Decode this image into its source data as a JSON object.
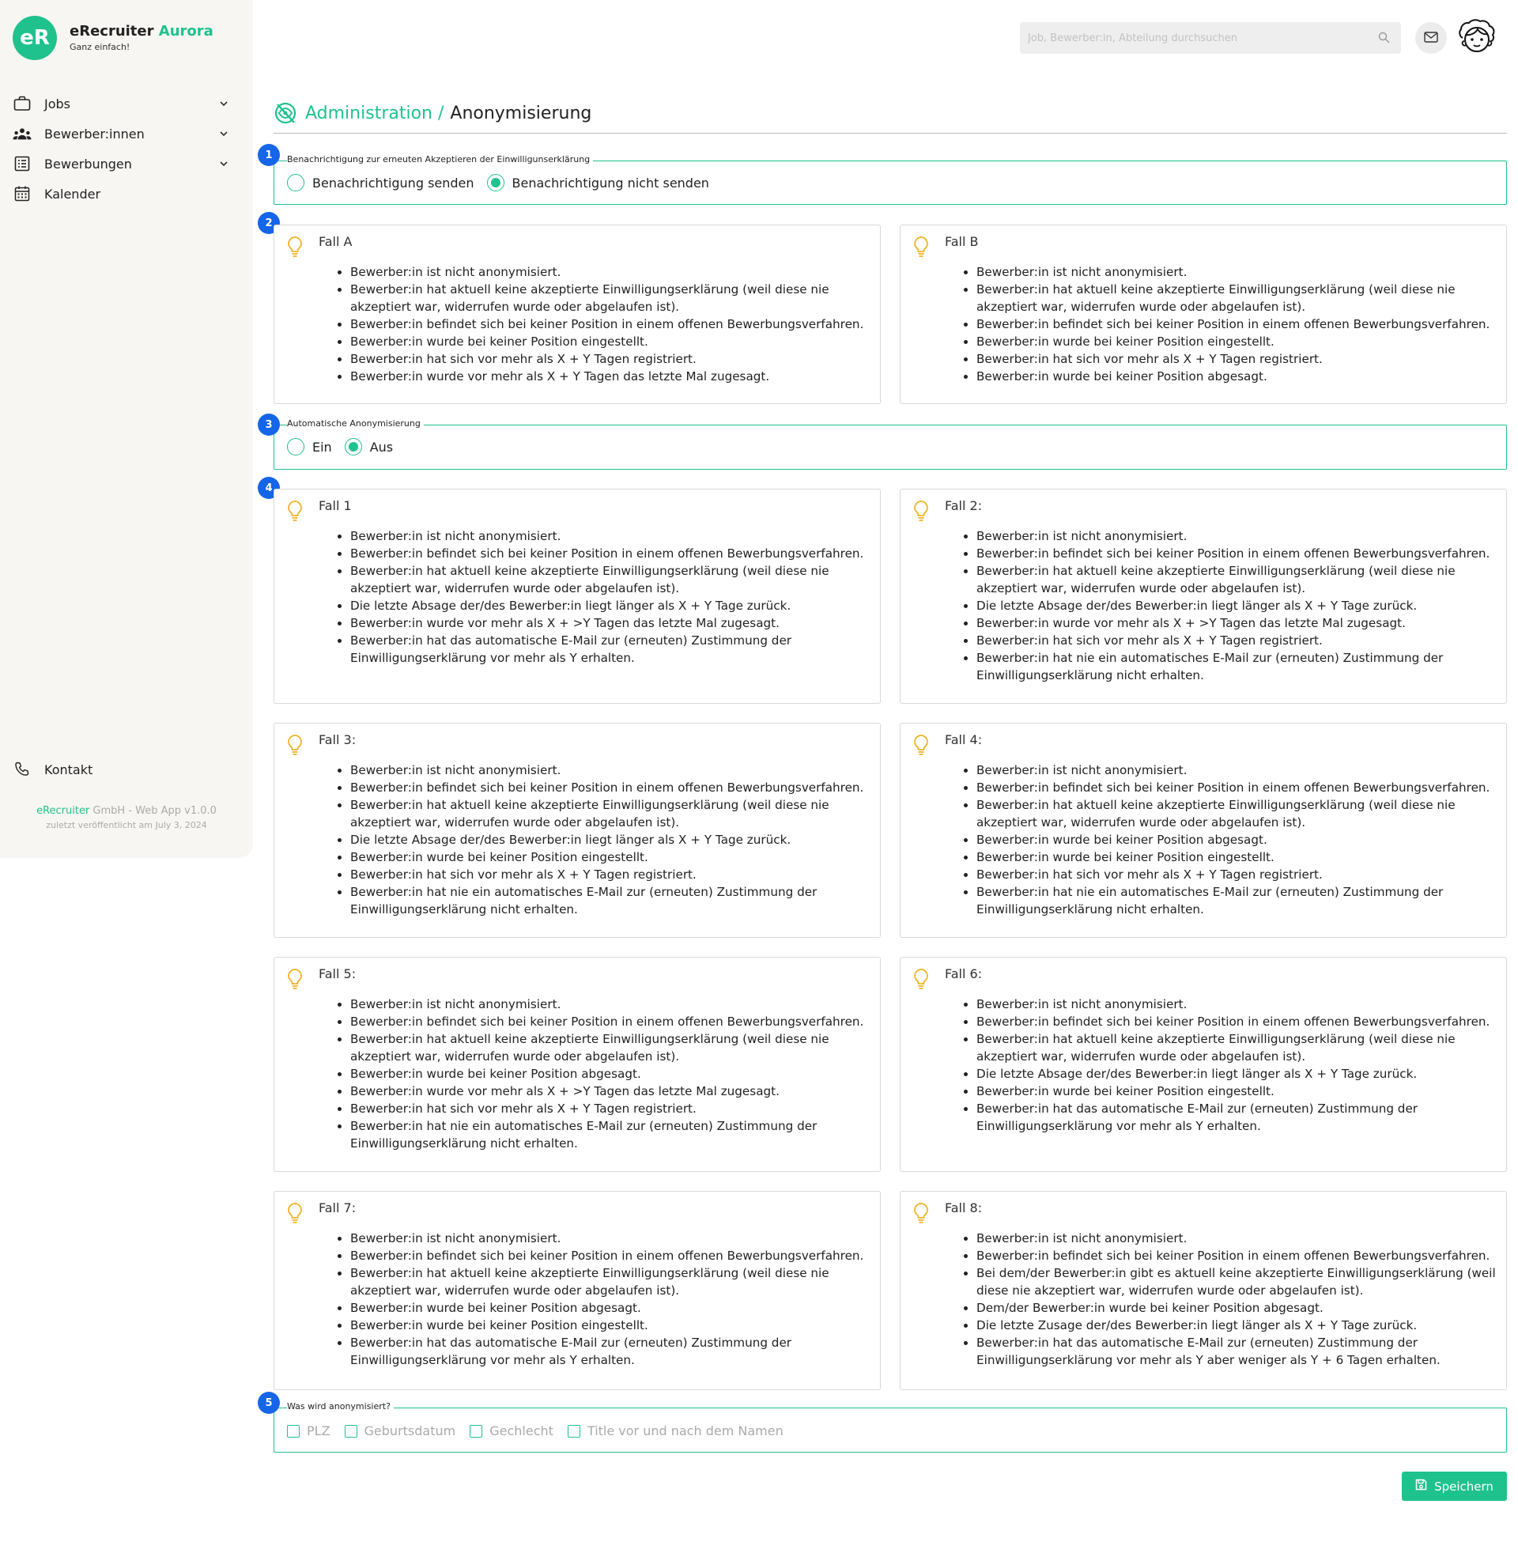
{
  "app": {
    "logo": "eR",
    "name": "eRecruiter",
    "name_accent": "Aurora",
    "tagline": "Ganz einfach!"
  },
  "sidebar": {
    "items": [
      {
        "label": "Jobs",
        "icon": "briefcase-icon"
      },
      {
        "label": "Bewerber:innen",
        "icon": "people-icon"
      },
      {
        "label": "Bewerbungen",
        "icon": "list-icon"
      },
      {
        "label": "Kalender",
        "icon": "calendar-icon"
      }
    ],
    "contact": "Kontakt",
    "footer_brand": "eRecruiter",
    "footer_rest": " GmbH - Web App v1.0.0",
    "footer_date": "zuletzt veröffentlicht am July 3, 2024"
  },
  "topbar": {
    "search_placeholder": "Job, Bewerber:in, Abteilung durchsuchen"
  },
  "breadcrumb": {
    "parent": "Administration /",
    "current": "Anonymisierung"
  },
  "section1": {
    "badge": "1",
    "legend": "Benachrichtigung zur erneuten Akzeptieren der Einwilligunserklärung",
    "option_send": "Benachrichtigung senden",
    "option_nosend": "Benachrichtigung nicht senden",
    "selected": "Benachrichtigung nicht senden"
  },
  "section2": {
    "badge": "2",
    "cases": [
      {
        "title": "Fall A",
        "items": [
          "Bewerber:in ist nicht anonymisiert.",
          "Bewerber:in hat aktuell keine akzeptierte Einwilligungserklärung (weil diese nie akzeptiert war, widerrufen wurde oder abgelaufen ist).",
          "Bewerber:in befindet sich bei keiner Position in einem offenen Bewerbungsverfahren.",
          "Bewerber:in wurde bei keiner Position eingestellt.",
          "Bewerber:in hat sich vor mehr als X + Y Tagen registriert.",
          "Bewerber:in wurde vor mehr als X + Y Tagen das letzte Mal zugesagt."
        ]
      },
      {
        "title": "Fall B",
        "items": [
          "Bewerber:in ist nicht anonymisiert.",
          "Bewerber:in hat aktuell keine akzeptierte Einwilligungserklärung (weil diese nie akzeptiert war, widerrufen wurde oder abgelaufen ist).",
          "Bewerber:in befindet sich bei keiner Position in einem offenen Bewerbungsverfahren.",
          "Bewerber:in wurde bei keiner Position eingestellt.",
          "Bewerber:in hat sich vor mehr als X + Y Tagen registriert.",
          "Bewerber:in wurde bei keiner Position abgesagt."
        ]
      }
    ]
  },
  "section3": {
    "badge": "3",
    "legend": "Automatische Anonymisierung",
    "option_on": "Ein",
    "option_off": "Aus",
    "selected": "Aus"
  },
  "section4": {
    "badge": "4",
    "cases": [
      {
        "title": "Fall 1",
        "items": [
          "Bewerber:in ist nicht anonymisiert.",
          "Bewerber:in befindet sich bei keiner Position in einem offenen Bewerbungsverfahren.",
          "Bewerber:in hat aktuell keine akzeptierte Einwilligungserklärung (weil diese nie akzeptiert war, widerrufen wurde oder abgelaufen ist).",
          "Die letzte Absage der/des Bewerber:in liegt länger als X + Y Tage zurück.",
          "Bewerber:in wurde vor mehr als X + >Y Tagen das letzte Mal zugesagt.",
          "Bewerber:in hat das automatische E-Mail zur (erneuten) Zustimmung der Einwilligungserklärung vor mehr als Y erhalten."
        ]
      },
      {
        "title": "Fall 2:",
        "items": [
          "Bewerber:in ist nicht anonymisiert.",
          "Bewerber:in befindet sich bei keiner Position in einem offenen Bewerbungsverfahren.",
          "Bewerber:in hat aktuell keine akzeptierte Einwilligungserklärung (weil diese nie akzeptiert war, widerrufen wurde oder abgelaufen ist).",
          "Die letzte Absage der/des Bewerber:in liegt länger als X + Y Tage zurück.",
          "Bewerber:in wurde vor mehr als X + >Y Tagen das letzte Mal zugesagt.",
          "Bewerber:in hat sich vor mehr als X + Y Tagen registriert.",
          "Bewerber:in hat nie ein automatisches E-Mail zur (erneuten) Zustimmung der Einwilligungserklärung nicht erhalten."
        ]
      },
      {
        "title": "Fall 3:",
        "items": [
          "Bewerber:in ist nicht anonymisiert.",
          "Bewerber:in befindet sich bei keiner Position in einem offenen Bewerbungsverfahren.",
          "Bewerber:in hat aktuell keine akzeptierte Einwilligungserklärung (weil diese nie akzeptiert war, widerrufen wurde oder abgelaufen ist).",
          "Die letzte Absage der/des Bewerber:in liegt länger als X + Y Tage zurück.",
          "Bewerber:in wurde bei keiner Position eingestellt.",
          "Bewerber:in hat sich vor mehr als X + Y Tagen registriert.",
          "Bewerber:in hat nie ein automatisches E-Mail zur (erneuten) Zustimmung der Einwilligungserklärung nicht erhalten."
        ]
      },
      {
        "title": "Fall 4:",
        "items": [
          "Bewerber:in ist nicht anonymisiert.",
          "Bewerber:in befindet sich bei keiner Position in einem offenen Bewerbungsverfahren.",
          "Bewerber:in hat aktuell keine akzeptierte Einwilligungserklärung (weil diese nie akzeptiert war, widerrufen wurde oder abgelaufen ist).",
          "Bewerber:in wurde bei keiner Position abgesagt.",
          "Bewerber:in wurde bei keiner Position eingestellt.",
          "Bewerber:in hat sich vor mehr als X + Y Tagen registriert.",
          "Bewerber:in hat nie ein automatisches E-Mail zur (erneuten) Zustimmung der Einwilligungserklärung nicht erhalten."
        ]
      },
      {
        "title": "Fall 5:",
        "items": [
          "Bewerber:in ist nicht anonymisiert.",
          "Bewerber:in befindet sich bei keiner Position in einem offenen Bewerbungsverfahren.",
          "Bewerber:in hat aktuell keine akzeptierte Einwilligungserklärung (weil diese nie akzeptiert war, widerrufen wurde oder abgelaufen ist).",
          "Bewerber:in wurde bei keiner Position abgesagt.",
          "Bewerber:in wurde vor mehr als X + >Y Tagen das letzte Mal zugesagt.",
          "Bewerber:in hat sich vor mehr als X + Y Tagen registriert.",
          "Bewerber:in hat nie ein automatisches E-Mail zur (erneuten) Zustimmung der Einwilligungserklärung nicht erhalten."
        ]
      },
      {
        "title": "Fall 6:",
        "items": [
          "Bewerber:in ist nicht anonymisiert.",
          "Bewerber:in befindet sich bei keiner Position in einem offenen Bewerbungsverfahren.",
          "Bewerber:in hat aktuell keine akzeptierte Einwilligungserklärung (weil diese nie akzeptiert war, widerrufen wurde oder abgelaufen ist).",
          "Die letzte Absage der/des Bewerber:in liegt länger als X + Y Tage zurück.",
          "Bewerber:in wurde bei keiner Position eingestellt.",
          "Bewerber:in hat das automatische E-Mail zur (erneuten) Zustimmung der Einwilligungserklärung vor mehr als Y erhalten."
        ]
      },
      {
        "title": "Fall 7:",
        "items": [
          "Bewerber:in ist nicht anonymisiert.",
          "Bewerber:in befindet sich bei keiner Position in einem offenen Bewerbungsverfahren.",
          "Bewerber:in hat aktuell keine akzeptierte Einwilligungserklärung (weil diese nie akzeptiert war, widerrufen wurde oder abgelaufen ist).",
          "Bewerber:in wurde bei keiner Position abgesagt.",
          "Bewerber:in wurde bei keiner Position eingestellt.",
          "Bewerber:in hat das automatische E-Mail zur (erneuten) Zustimmung der Einwilligungserklärung vor mehr als Y erhalten."
        ]
      },
      {
        "title": "Fall 8:",
        "items": [
          "Bewerber:in ist nicht anonymisiert.",
          "Bewerber:in befindet sich bei keiner Position in einem offenen Bewerbungsverfahren.",
          "Bei dem/der Bewerber:in gibt es aktuell keine akzeptierte Einwilligungserklärung (weil diese nie akzeptiert war, widerrufen wurde oder abgelaufen ist).",
          "Dem/der Bewerber:in wurde bei keiner Position abgesagt.",
          "Die letzte Zusage der/des Bewerber:in liegt länger als X + Y Tage zurück.",
          "Bewerber:in hat das automatische E-Mail zur (erneuten) Zustimmung der Einwilligungserklärung vor mehr als Y aber weniger als Y + 6 Tagen erhalten."
        ]
      }
    ]
  },
  "section5": {
    "badge": "5",
    "legend": "Was wird anonymisiert?",
    "options": [
      "PLZ",
      "Geburtsdatum",
      "Gechlecht",
      "Title vor und nach dem Namen"
    ]
  },
  "actions": {
    "save": "Speichern"
  },
  "colors": {
    "accent": "#1fc28d",
    "badge": "#1565e8",
    "bulb": "#f0b429",
    "sidebar_bg": "#f7f6f3"
  }
}
